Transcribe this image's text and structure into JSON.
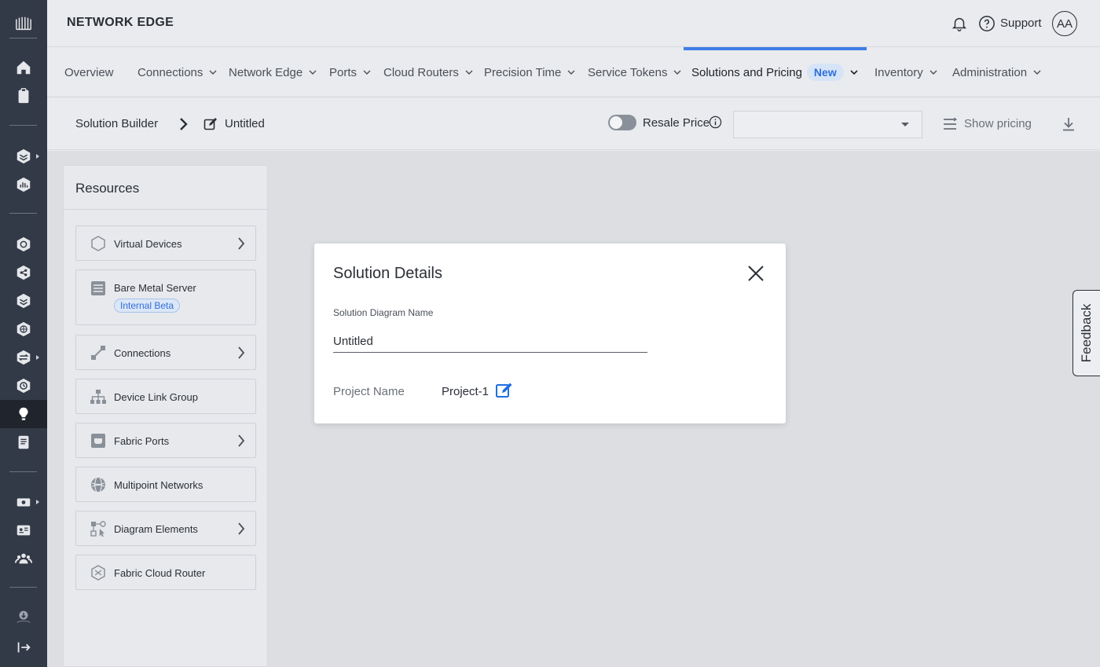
{
  "header": {
    "brand": "NETWORK EDGE",
    "support_label": "Support",
    "avatar_initials": "AA"
  },
  "nav": {
    "tabs": [
      {
        "label": "Overview",
        "has_dropdown": false
      },
      {
        "label": "Connections",
        "has_dropdown": true
      },
      {
        "label": "Network Edge",
        "has_dropdown": true
      },
      {
        "label": "Ports",
        "has_dropdown": true
      },
      {
        "label": "Cloud Routers",
        "has_dropdown": true
      },
      {
        "label": "Precision Time",
        "has_dropdown": true
      },
      {
        "label": "Service Tokens",
        "has_dropdown": true
      },
      {
        "label": "Solutions and Pricing",
        "has_dropdown": true,
        "active": true,
        "badge": "New"
      },
      {
        "label": "Inventory",
        "has_dropdown": true
      },
      {
        "label": "Administration",
        "has_dropdown": true
      }
    ],
    "accent_color": "#3f7ee8"
  },
  "toolbar": {
    "breadcrumb_root": "Solution Builder",
    "breadcrumb_current": "Untitled",
    "resale_label": "Resale Price",
    "resale_enabled": false,
    "currency_select_value": "",
    "show_pricing_label": "Show pricing"
  },
  "resources": {
    "title": "Resources",
    "items": [
      {
        "label": "Virtual Devices",
        "icon": "hexagon-outline-icon",
        "has_submenu": true
      },
      {
        "label": "Bare Metal Server",
        "icon": "server-icon",
        "has_submenu": false,
        "badge": "Internal Beta"
      },
      {
        "label": "Connections",
        "icon": "connection-link-icon",
        "has_submenu": true
      },
      {
        "label": "Device Link Group",
        "icon": "hierarchy-icon",
        "has_submenu": false
      },
      {
        "label": "Fabric Ports",
        "icon": "port-icon",
        "has_submenu": true
      },
      {
        "label": "Multipoint Networks",
        "icon": "globe-network-icon",
        "has_submenu": false
      },
      {
        "label": "Diagram Elements",
        "icon": "diagram-elements-icon",
        "has_submenu": true
      },
      {
        "label": "Fabric Cloud Router",
        "icon": "cloud-router-icon",
        "has_submenu": false
      }
    ]
  },
  "feedback": {
    "label": "Feedback"
  },
  "modal": {
    "title": "Solution Details",
    "field_label": "Solution Diagram Name",
    "field_value": "Untitled",
    "project_label": "Project Name",
    "project_value": "Project-1"
  }
}
